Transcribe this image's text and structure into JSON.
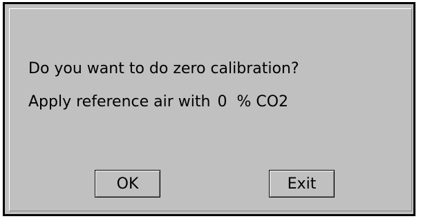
{
  "dialog": {
    "question": "Do you want to do zero calibration?",
    "instruction_prefix": "Apply reference air with",
    "co2_value": "0",
    "co2_unit": "% CO2",
    "ok_label": "OK",
    "exit_label": "Exit"
  },
  "colors": {
    "dialog_background": "#c0c0c0",
    "border": "#000000"
  }
}
